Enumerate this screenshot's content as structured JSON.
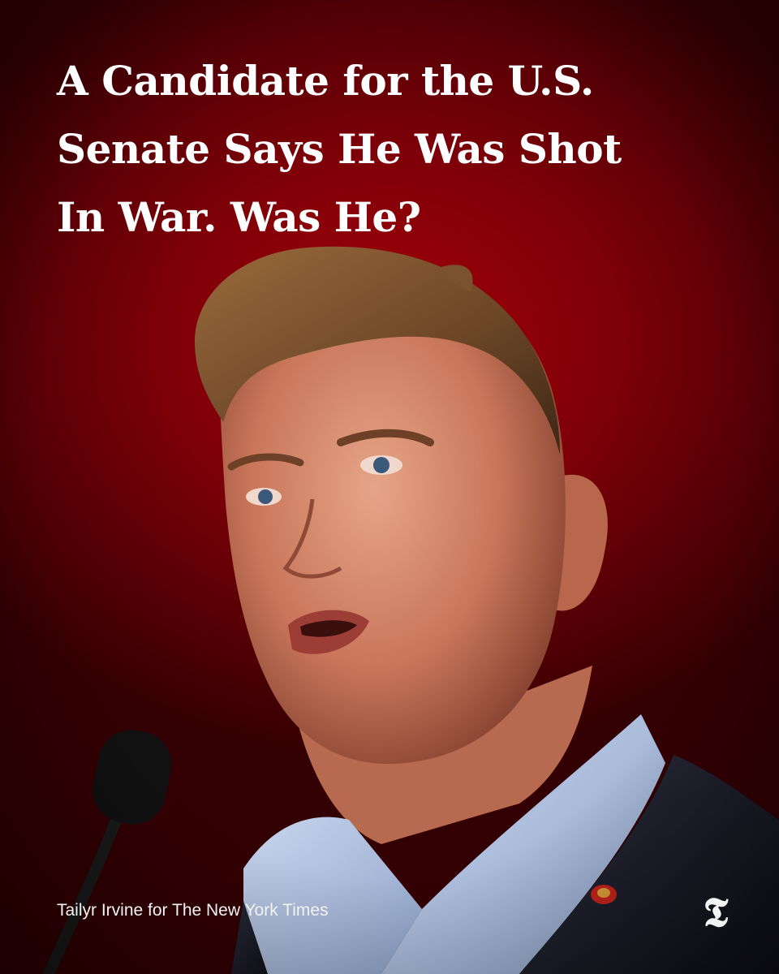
{
  "headline": {
    "lines": [
      "A Candidate for the U.S.",
      "Senate Says He Was Shot",
      "In War. Was He?"
    ]
  },
  "photo_credit": "Tailyr Irvine for The New York Times",
  "brand": {
    "logo_glyph": "𝕿"
  },
  "colors": {
    "background_red": "#8f0008",
    "text": "#ffffff"
  }
}
